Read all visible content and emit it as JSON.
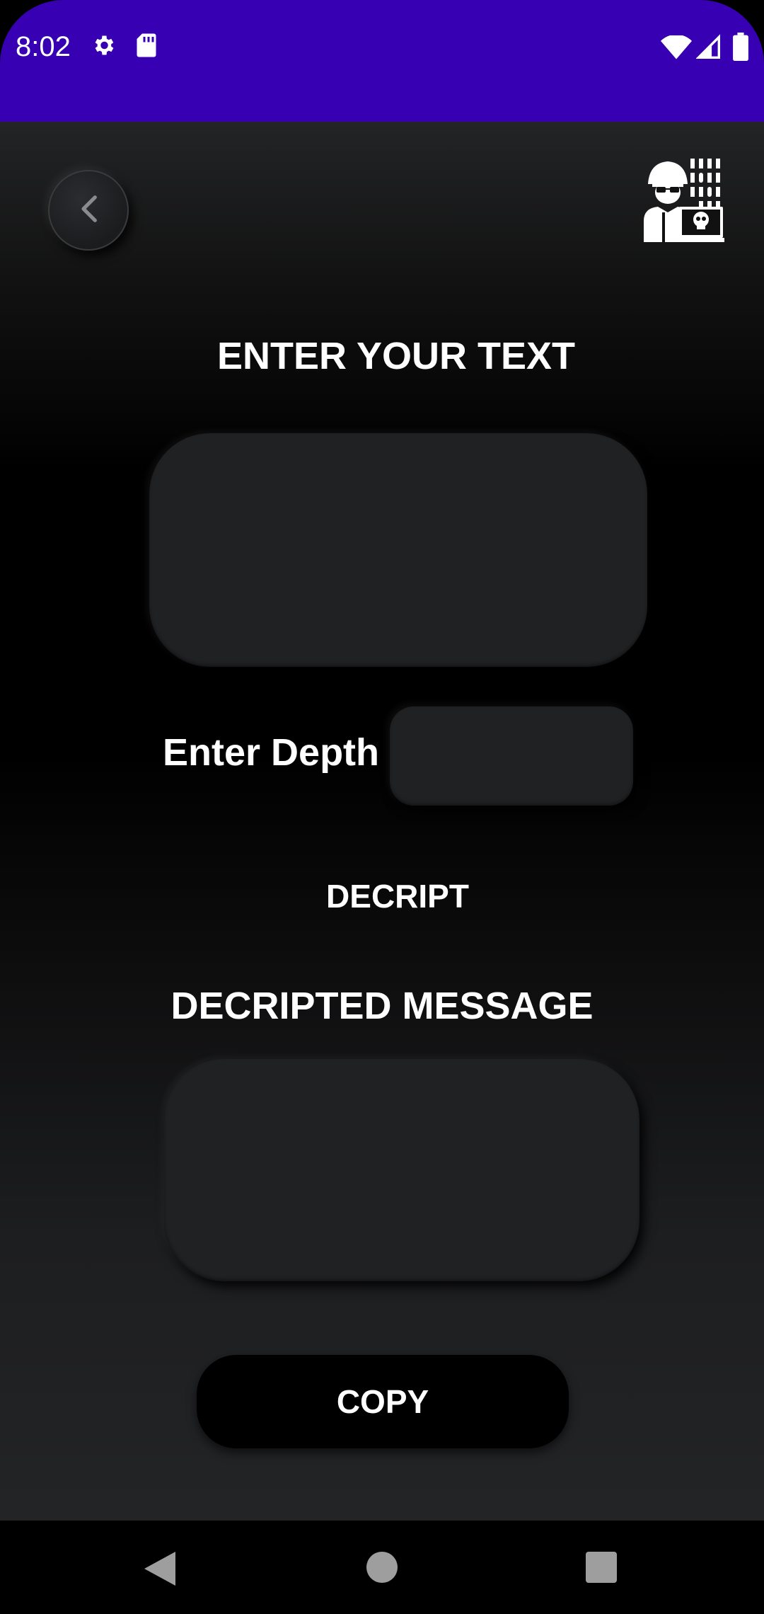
{
  "status_bar": {
    "time": "8:02",
    "icons": [
      "gear-icon",
      "sd-card-icon",
      "wifi-icon",
      "signal-icon",
      "battery-icon"
    ],
    "background": "#3700b3"
  },
  "header": {
    "back_icon": "chevron-left-icon",
    "logo_icon": "hacker-logo-icon"
  },
  "form": {
    "title": "ENTER YOUR TEXT",
    "text_value": "",
    "depth_label": "Enter Depth",
    "depth_value": "",
    "decript_label": "DECRIPT"
  },
  "result": {
    "title": "DECRIPTED MESSAGE",
    "message": "",
    "copy_label": "COPY"
  },
  "nav_bar": {
    "icons": [
      "back-triangle-icon",
      "home-circle-icon",
      "recents-square-icon"
    ]
  }
}
